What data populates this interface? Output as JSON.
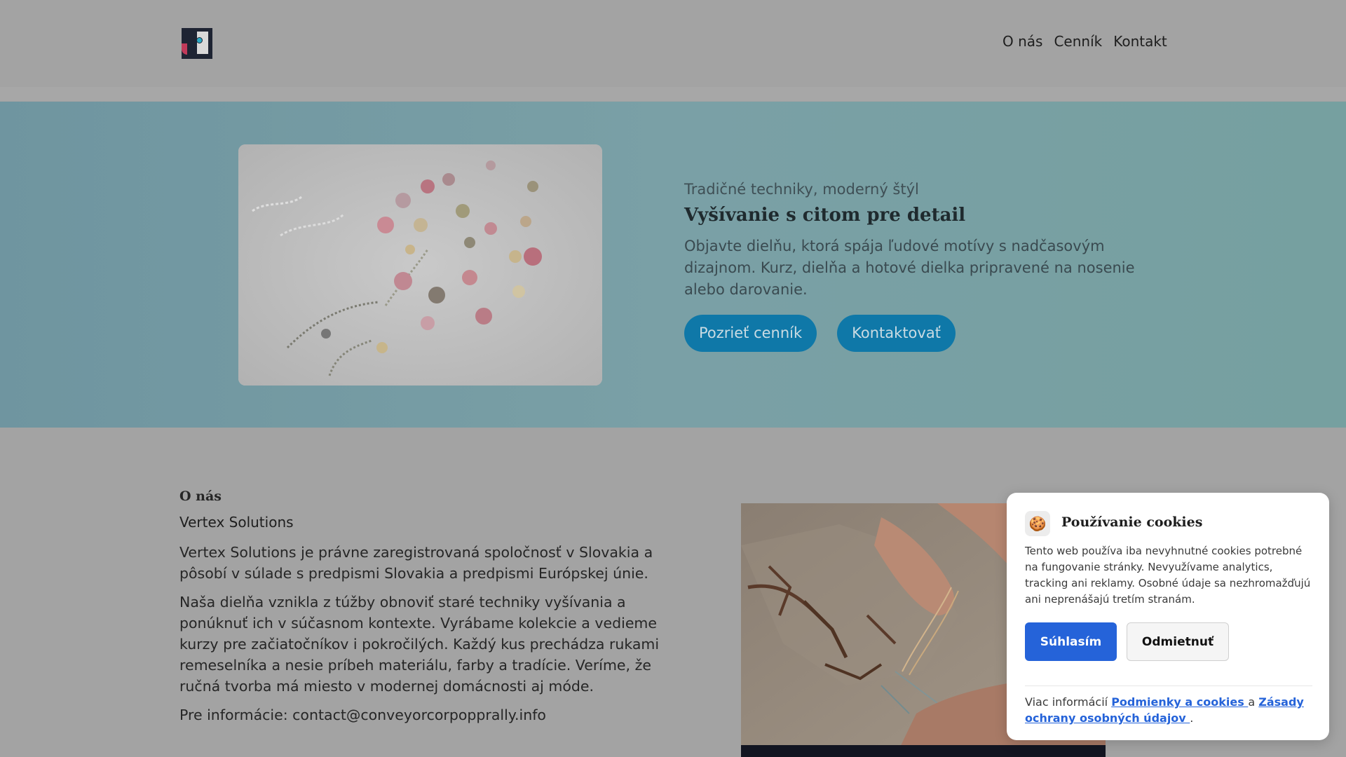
{
  "nav": {
    "items": [
      "O nás",
      "Cenník",
      "Kontakt"
    ]
  },
  "hero": {
    "kicker": "Tradičné techniky, moderný štýl",
    "title": "Vyšívanie s citom pre detail",
    "description": "Objavte dielňu, ktorá spája ľudové motívy s nadčasovým dizajnom. Kurz, dielňa a hotové dielka pripravené na nosenie alebo darovanie.",
    "primary_button": "Pozrieť cenník",
    "secondary_button": "Kontaktovať"
  },
  "about": {
    "heading": "O nás",
    "company": "Vertex Solutions",
    "paragraph1": "Vertex Solutions je právne zaregistrovaná spoločnosť v Slovakia a pôsobí v súlade s predpismi Slovakia a predpismi Európskej únie.",
    "paragraph2": "Naša dielňa vznikla z túžby obnoviť staré techniky vyšívania a ponúknuť ich v súčasnom kontexte. Vyrábame kolekcie a vedieme kurzy pre začiatočníkov i pokročilých. Každý kus prechádza rukami remeselníka a nesie príbeh materiálu, farby a tradície. Veríme, že ručná tvorba má miesto v modernej domácnosti aj móde.",
    "contact": "Pre informácie: contact@conveyorcorpopprally.info"
  },
  "cookie": {
    "icon": "cookie-icon",
    "title": "Používanie cookies",
    "text": "Tento web používa iba nevyhnutné cookies potrebné na fungovanie stránky. Nevyužívame analytics, tracking ani reklamy. Osobné údaje sa nezhromažďujú ani neprenášajú tretím stranám.",
    "accept": "Súhlasím",
    "decline": "Odmietnuť",
    "more_prefix": "Viac informácií",
    "link_terms": "Podmienky a cookies ",
    "connector": "a",
    "link_privacy": "Zásady ochrany osobných údajov ",
    "period": "."
  },
  "colors": {
    "accent": "#2563d9",
    "hero_button": "#0f78a8"
  }
}
